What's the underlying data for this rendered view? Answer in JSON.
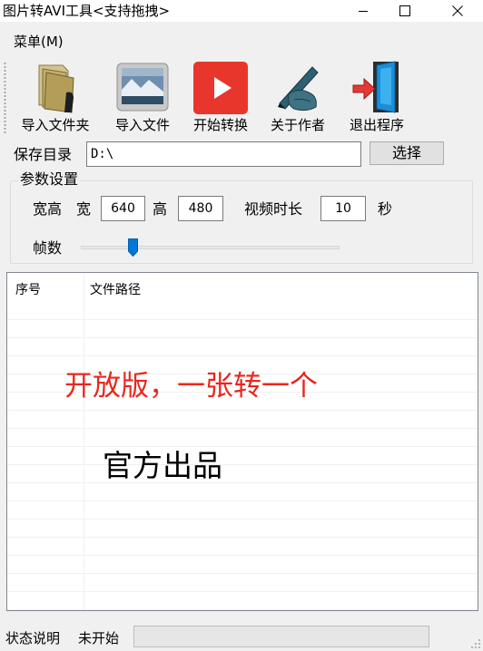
{
  "window": {
    "title": "图片转AVI工具<支持拖拽>"
  },
  "menu": {
    "label": "菜单(M)"
  },
  "toolbar": {
    "buttons": [
      {
        "label": "导入文件夹",
        "icon": "folder-icon"
      },
      {
        "label": "导入文件",
        "icon": "image-file-icon"
      },
      {
        "label": "开始转换",
        "icon": "play-icon"
      },
      {
        "label": "关于作者",
        "icon": "pen-hand-icon"
      },
      {
        "label": "退出程序",
        "icon": "exit-door-icon"
      }
    ]
  },
  "save": {
    "label": "保存目录",
    "value": "D:\\",
    "choose_label": "选择"
  },
  "params": {
    "legend": "参数设置",
    "size_label": "宽高",
    "width_label": "宽",
    "width_value": "640",
    "height_label": "高",
    "height_value": "480",
    "duration_label": "视频时长",
    "duration_value": "10",
    "duration_unit": "秒",
    "fps_label": "帧数",
    "fps_slider_fraction": 0.2
  },
  "list": {
    "columns": [
      "序号",
      "文件路径"
    ]
  },
  "overlay": {
    "red_text": "开放版，一张转一个",
    "black_text": "官方出品"
  },
  "status": {
    "label": "状态说明",
    "value": "未开始",
    "progress": 0
  },
  "colors": {
    "accent_red": "#e8271e",
    "play_button": "#e8362c"
  }
}
